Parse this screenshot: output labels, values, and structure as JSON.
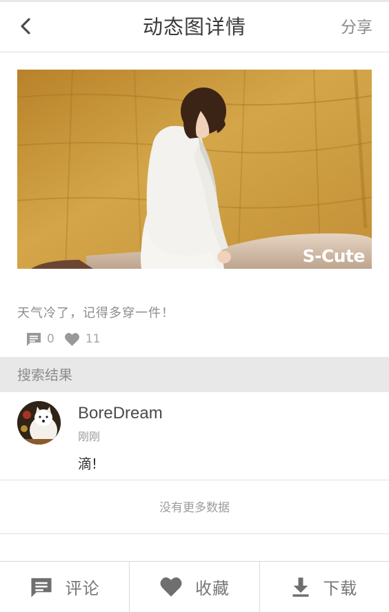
{
  "header": {
    "title": "动态图详情",
    "share_label": "分享"
  },
  "post": {
    "watermark": "S-Cute",
    "caption": "天气冷了，记得多穿一件！",
    "comment_count": "0",
    "like_count": "11"
  },
  "section": {
    "title": "搜索结果"
  },
  "results": [
    {
      "username": "BoreDream",
      "time": "刚刚",
      "text": "滴!"
    }
  ],
  "footer_note": "没有更多数据",
  "bottom_bar": {
    "comment_label": "评论",
    "favorite_label": "收藏",
    "download_label": "下载"
  },
  "colors": {
    "icon_gray": "#999999",
    "bottom_icon": "#6f6f6f",
    "section_bg": "#e8e8e8"
  }
}
